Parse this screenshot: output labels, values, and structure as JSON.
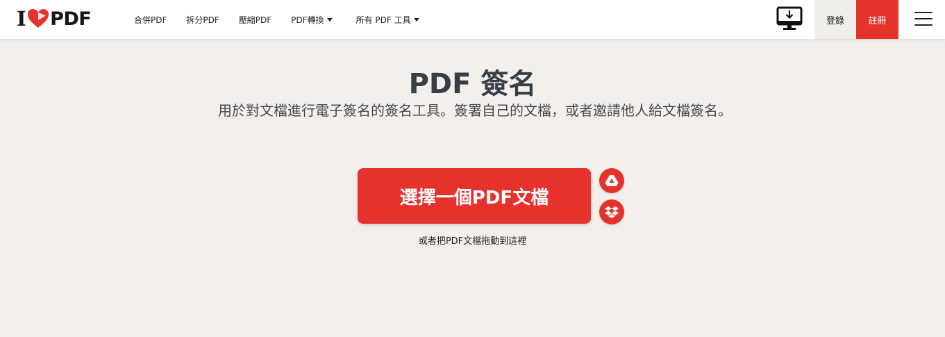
{
  "header": {
    "logo": {
      "left": "I",
      "right": "PDF"
    },
    "nav": [
      {
        "label": "合併PDF",
        "dropdown": false
      },
      {
        "label": "拆分PDF",
        "dropdown": false
      },
      {
        "label": "壓縮PDF",
        "dropdown": false
      },
      {
        "label": "PDF轉換",
        "dropdown": true
      },
      {
        "label": "所有 PDF 工具",
        "dropdown": true
      }
    ],
    "login_label": "登錄",
    "signup_label": "註冊"
  },
  "main": {
    "title": "PDF 簽名",
    "subtitle": "用於對文檔進行電子簽名的簽名工具。簽署自己的文檔，或者邀請他人給文檔簽名。",
    "select_button_label": "選擇一個PDF文檔",
    "drop_hint": "或者把PDF文檔拖動到這裡"
  },
  "colors": {
    "brand_red": "#e5322d",
    "background": "#f3f0ec",
    "title_text": "#383e45"
  },
  "icons": {
    "desktop": "desktop-download-icon",
    "menu": "hamburger-menu-icon",
    "google_drive": "google-drive-icon",
    "dropbox": "dropbox-icon"
  }
}
